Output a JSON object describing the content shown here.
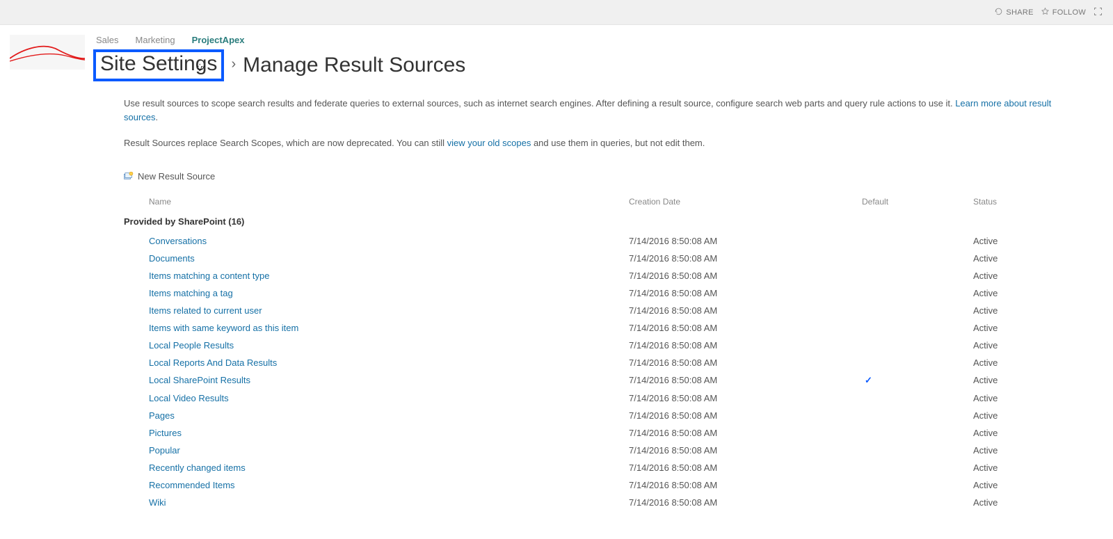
{
  "ribbon": {
    "share": "SHARE",
    "follow": "FOLLOW"
  },
  "topnav": {
    "items": [
      {
        "label": "Sales",
        "active": false
      },
      {
        "label": "Marketing",
        "active": false
      },
      {
        "label": "ProjectApex",
        "active": true
      }
    ]
  },
  "breadcrumb": {
    "site_settings": "Site Settings",
    "separator": "›",
    "current": "Manage Result Sources"
  },
  "intro": {
    "p1a": "Use result sources to scope search results and federate queries to external sources, such as internet search engines. After defining a result source, configure search web parts and query rule actions to use it. ",
    "p1link": "Learn more about result sources",
    "p1b": ".",
    "p2a": "Result Sources replace Search Scopes, which are now deprecated. You can still ",
    "p2link": "view your old scopes",
    "p2b": " and use them in queries, but not edit them."
  },
  "new_source_label": "New Result Source",
  "table": {
    "headers": {
      "name": "Name",
      "creation_date": "Creation Date",
      "default": "Default",
      "status": "Status"
    },
    "group_label": "Provided by SharePoint (16)",
    "rows": [
      {
        "name": "Conversations",
        "date": "7/14/2016 8:50:08 AM",
        "default": false,
        "status": "Active"
      },
      {
        "name": "Documents",
        "date": "7/14/2016 8:50:08 AM",
        "default": false,
        "status": "Active"
      },
      {
        "name": "Items matching a content type",
        "date": "7/14/2016 8:50:08 AM",
        "default": false,
        "status": "Active"
      },
      {
        "name": "Items matching a tag",
        "date": "7/14/2016 8:50:08 AM",
        "default": false,
        "status": "Active"
      },
      {
        "name": "Items related to current user",
        "date": "7/14/2016 8:50:08 AM",
        "default": false,
        "status": "Active"
      },
      {
        "name": "Items with same keyword as this item",
        "date": "7/14/2016 8:50:08 AM",
        "default": false,
        "status": "Active"
      },
      {
        "name": "Local People Results",
        "date": "7/14/2016 8:50:08 AM",
        "default": false,
        "status": "Active"
      },
      {
        "name": "Local Reports And Data Results",
        "date": "7/14/2016 8:50:08 AM",
        "default": false,
        "status": "Active"
      },
      {
        "name": "Local SharePoint Results",
        "date": "7/14/2016 8:50:08 AM",
        "default": true,
        "status": "Active"
      },
      {
        "name": "Local Video Results",
        "date": "7/14/2016 8:50:08 AM",
        "default": false,
        "status": "Active"
      },
      {
        "name": "Pages",
        "date": "7/14/2016 8:50:08 AM",
        "default": false,
        "status": "Active"
      },
      {
        "name": "Pictures",
        "date": "7/14/2016 8:50:08 AM",
        "default": false,
        "status": "Active"
      },
      {
        "name": "Popular",
        "date": "7/14/2016 8:50:08 AM",
        "default": false,
        "status": "Active"
      },
      {
        "name": "Recently changed items",
        "date": "7/14/2016 8:50:08 AM",
        "default": false,
        "status": "Active"
      },
      {
        "name": "Recommended Items",
        "date": "7/14/2016 8:50:08 AM",
        "default": false,
        "status": "Active"
      },
      {
        "name": "Wiki",
        "date": "7/14/2016 8:50:08 AM",
        "default": false,
        "status": "Active"
      }
    ]
  }
}
